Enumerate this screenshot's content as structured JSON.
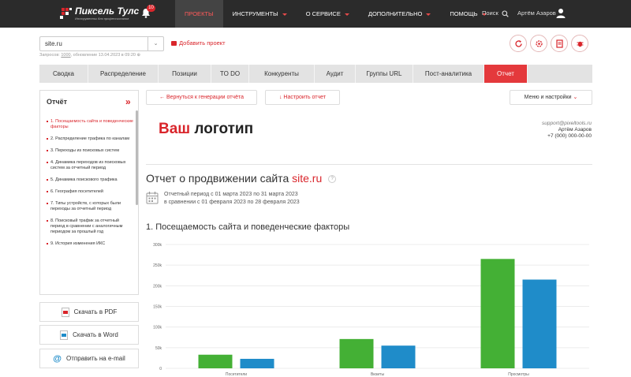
{
  "header": {
    "logo_name": "Пиксель Тулс",
    "logo_tagline": "Инструменты для профессионалов",
    "notifications_count": "10",
    "nav": [
      {
        "label": "ПРОЕКТЫ",
        "active": true,
        "dropdown": false
      },
      {
        "label": "ИНСТРУМЕНТЫ",
        "active": false,
        "dropdown": true
      },
      {
        "label": "О СЕРВИСЕ",
        "active": false,
        "dropdown": true
      },
      {
        "label": "ДОПОЛНИТЕЛЬНО",
        "active": false,
        "dropdown": true
      },
      {
        "label": "ПОМОЩЬ",
        "active": false,
        "dropdown": true
      }
    ],
    "search_label": "Поиск",
    "user_name": "Артём Азаров"
  },
  "project": {
    "site": "site.ru",
    "add_project": "Добавить проект",
    "meta_requests_label": "Запросов:",
    "meta_requests_value": "1000",
    "meta_updated": "обновление 13.04.2023 в 09:20"
  },
  "tabs": [
    {
      "label": "Сводка",
      "active": false
    },
    {
      "label": "Распределение",
      "active": false
    },
    {
      "label": "Позиции",
      "active": false
    },
    {
      "label": "TO DO",
      "active": false
    },
    {
      "label": "Конкуренты",
      "active": false
    },
    {
      "label": "Аудит",
      "active": false
    },
    {
      "label": "Группы URL",
      "active": false
    },
    {
      "label": "Пост-аналитика",
      "active": false
    },
    {
      "label": "Отчет",
      "active": true
    }
  ],
  "sidebar": {
    "title": "Отчёт",
    "items": [
      {
        "label": "1. Посещаемость сайта и поведенческие факторы",
        "active": true
      },
      {
        "label": "2. Распределение трафика по каналам",
        "active": false
      },
      {
        "label": "3. Переходы из поисковых систем",
        "active": false
      },
      {
        "label": "4. Динамика переходов из поисковых систем за отчетный период",
        "active": false
      },
      {
        "label": "5. Динамика поискового трафика",
        "active": false
      },
      {
        "label": "6. География посетителей",
        "active": false
      },
      {
        "label": "7. Типы устройств, с которых были переходы за отчетный период",
        "active": false
      },
      {
        "label": "8. Поисковый трафик за отчетный период в сравнении с аналогичным периодом за прошлый год",
        "active": false
      },
      {
        "label": "9. История изменения ИКС",
        "active": false
      }
    ]
  },
  "downloads": {
    "pdf": "Скачать в PDF",
    "word": "Скачать в Word",
    "email": "Отправить на e-mail"
  },
  "toolbar": {
    "back": "← Вернуться к генерации отчёта",
    "settings": "↓ Настроить отчет",
    "menu": "Меню и настройки"
  },
  "report": {
    "logo_red": "Ваш",
    "logo_black": "логотип",
    "contact_email": "support@pixeltools.ru",
    "contact_name": "Артём Азаров",
    "contact_phone": "+7 (000) 000-00-00",
    "title_prefix": "Отчет о продвижении сайта",
    "title_site": "site.ru",
    "help": "?",
    "period_line1": "Отчетный период с 01 марта 2023 по 31 марта 2023",
    "period_line2": "в сравнении с 01 февраля 2023 по 28 февраля 2023",
    "section_title": "1. Посещаемость сайта и поведенческие факторы"
  },
  "colors": {
    "accent": "#d9252b",
    "series_current": "#44b035",
    "series_previous": "#1f8cc9",
    "header_bg": "#2b2b2b"
  },
  "chart_data": {
    "type": "bar",
    "categories": [
      "Посетители",
      "Визиты",
      "Просмотры"
    ],
    "series": [
      {
        "values": [
          33000,
          71000,
          265000
        ],
        "color": "#44b035"
      },
      {
        "values": [
          23000,
          55000,
          215000
        ],
        "color": "#1f8cc9"
      }
    ],
    "yticks": [
      "0",
      "50k",
      "100k",
      "150k",
      "200k",
      "250k",
      "300k"
    ],
    "ylim": [
      0,
      300000
    ],
    "grid": true
  }
}
